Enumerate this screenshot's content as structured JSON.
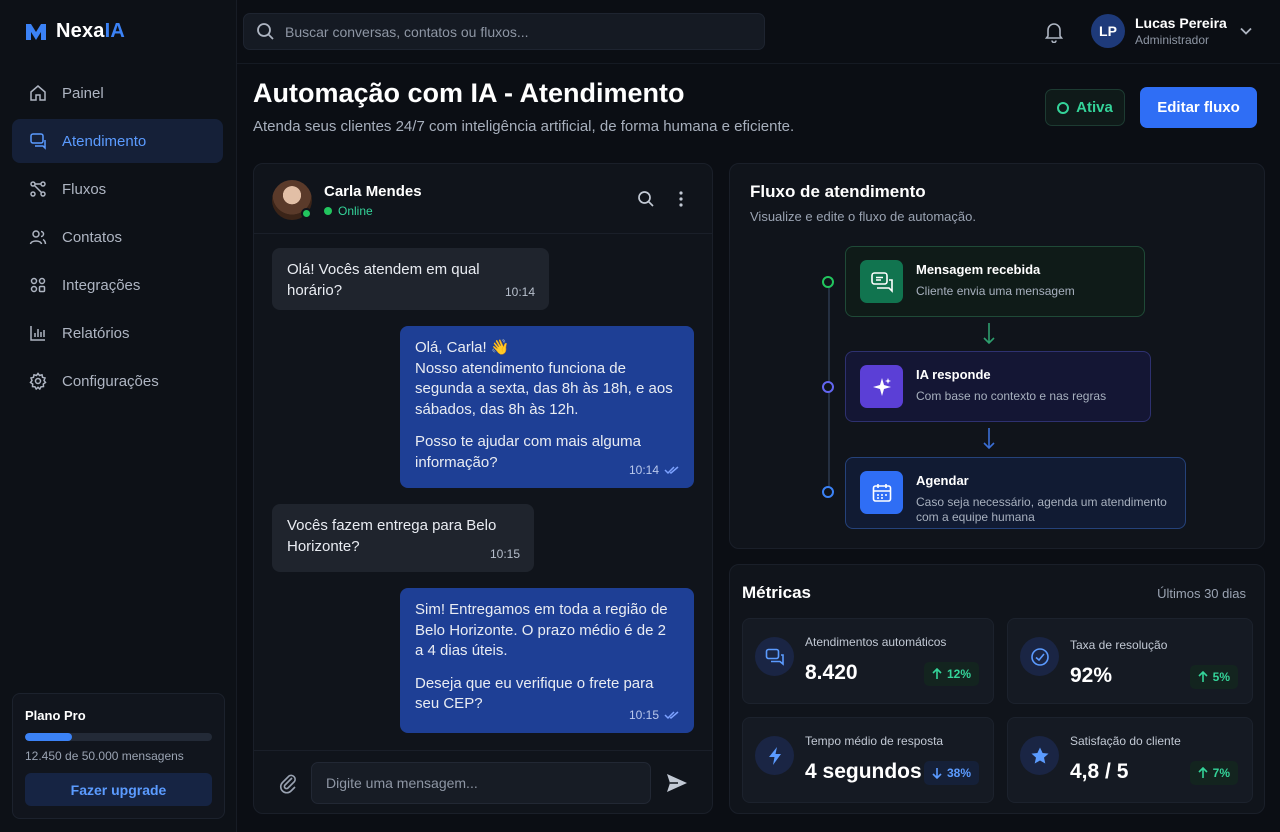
{
  "brand": {
    "name_prefix": "Nexa",
    "name_suffix": "IA"
  },
  "search": {
    "placeholder": "Buscar conversas, contatos ou fluxos..."
  },
  "user": {
    "initials": "LP",
    "name": "Lucas Pereira",
    "role": "Administrador"
  },
  "sidebar": {
    "items": [
      {
        "label": "Painel",
        "icon": "home-icon"
      },
      {
        "label": "Atendimento",
        "icon": "chat-icon",
        "active": true
      },
      {
        "label": "Fluxos",
        "icon": "flow-icon"
      },
      {
        "label": "Contatos",
        "icon": "contacts-icon"
      },
      {
        "label": "Integrações",
        "icon": "integrations-icon"
      },
      {
        "label": "Relatórios",
        "icon": "reports-icon"
      },
      {
        "label": "Configurações",
        "icon": "gear-icon"
      }
    ]
  },
  "plan": {
    "title": "Plano Pro",
    "usage_text": "12.450 de 50.000 mensagens",
    "usage_fraction": 0.249,
    "upgrade_label": "Fazer upgrade"
  },
  "header": {
    "title": "Automação com IA - Atendimento",
    "subtitle": "Atenda seus clientes 24/7 com inteligência artificial, de forma humana e eficiente.",
    "status_label": "Ativa",
    "edit_label": "Editar fluxo"
  },
  "chat": {
    "contact_name": "Carla Mendes",
    "contact_status": "Online",
    "messages": [
      {
        "direction": "in",
        "paragraphs": [
          "Olá! Vocês atendem em qual horário?"
        ],
        "time": "10:14"
      },
      {
        "direction": "out",
        "paragraphs": [
          "Olá, Carla! 👋\nNosso atendimento funciona de segunda a sexta, das 8h às 18h, e aos sábados, das 8h às 12h.",
          "Posso te ajudar com mais alguma informação?"
        ],
        "time": "10:14"
      },
      {
        "direction": "in",
        "paragraphs": [
          "Vocês fazem entrega para Belo Horizonte?"
        ],
        "time": "10:15"
      },
      {
        "direction": "out",
        "paragraphs": [
          "Sim! Entregamos em toda a região de Belo Horizonte. O prazo médio é de 2 a 4 dias úteis.",
          "Deseja que eu verifique o frete para seu CEP?"
        ],
        "time": "10:15"
      }
    ],
    "input_placeholder": "Digite uma mensagem..."
  },
  "flow": {
    "title": "Fluxo de atendimento",
    "subtitle": "Visualize e edite o fluxo de automação.",
    "steps": [
      {
        "title": "Mensagem recebida",
        "desc": "Cliente envia uma mensagem",
        "color": "#22c55e"
      },
      {
        "title": "IA responde",
        "desc": "Com base no contexto e nas regras",
        "color": "#7c3aed"
      },
      {
        "title": "Agendar",
        "desc": "Caso seja necessário, agenda um atendimento com a equipe humana",
        "color": "#3b82f6"
      }
    ]
  },
  "metrics": {
    "title": "Métricas",
    "range": "Últimos 30 dias",
    "cards": [
      {
        "label": "Atendimentos automáticos",
        "value": "8.420",
        "delta": "12%",
        "trend": "up",
        "icon": "chat-bubbles-icon"
      },
      {
        "label": "Taxa de resolução",
        "value": "92%",
        "delta": "5%",
        "trend": "up",
        "icon": "check-circle-icon"
      },
      {
        "label": "Tempo médio de resposta",
        "value": "4 segundos",
        "delta": "38%",
        "trend": "down",
        "icon": "bolt-icon"
      },
      {
        "label": "Satisfação do cliente",
        "value": "4,8 / 5",
        "delta": "7%",
        "trend": "up",
        "icon": "star-icon"
      }
    ]
  },
  "colors": {
    "accent": "#3b82f6",
    "success": "#34d399",
    "bubble_out": "#1e3f95"
  }
}
